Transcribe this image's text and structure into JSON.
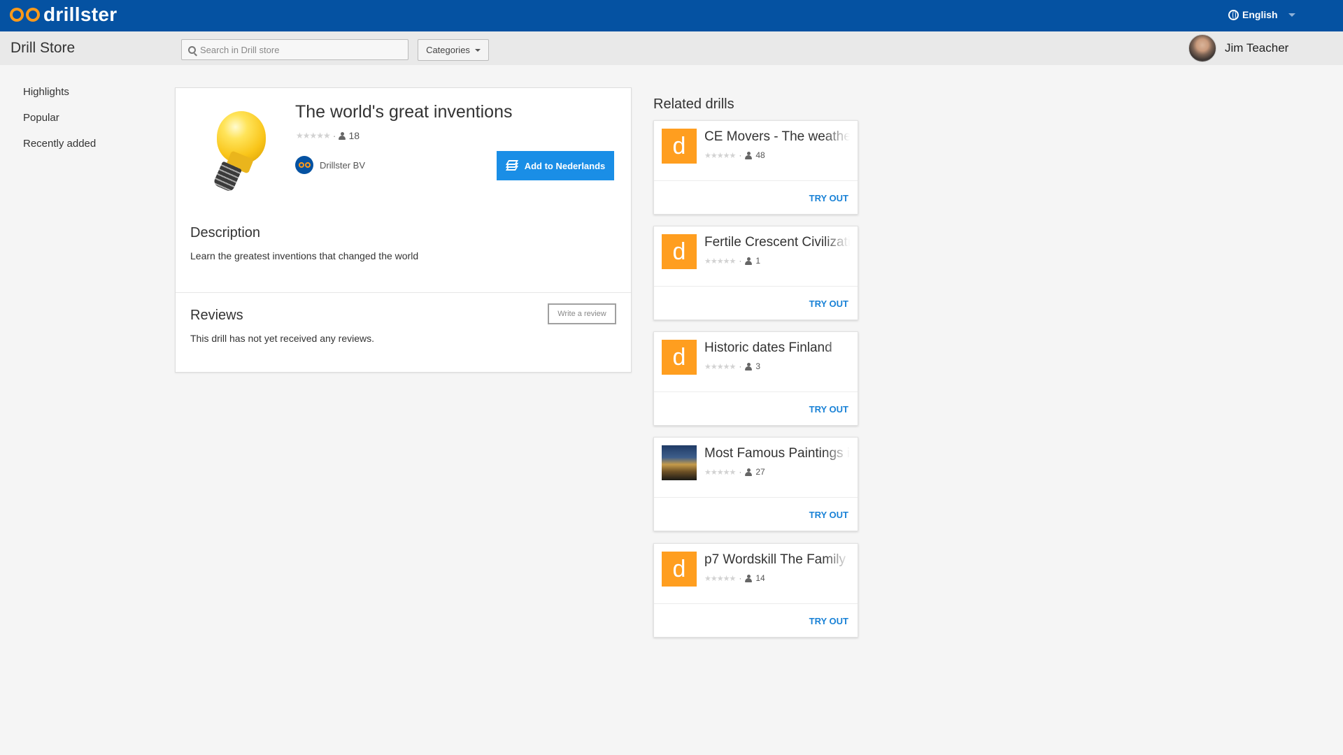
{
  "topbar": {
    "brand": "drillster",
    "language": "English"
  },
  "subbar": {
    "store_title": "Drill Store",
    "search_placeholder": "Search in Drill store",
    "categories_label": "Categories",
    "user_name": "Jim Teacher"
  },
  "nav": {
    "items": [
      "Highlights",
      "Popular",
      "Recently added"
    ]
  },
  "drill": {
    "title": "The world's great inventions",
    "rating_stars": "★★★★★",
    "rating_value": 0,
    "users_count": "18",
    "owner": "Drillster BV",
    "add_button_label": "Add to Nederlands",
    "description_heading": "Description",
    "description_text": "Learn the greatest inventions that changed the world",
    "reviews_heading": "Reviews",
    "reviews_text": "This drill has not yet received any reviews.",
    "write_review_label": "Write a review"
  },
  "related": {
    "heading": "Related drills",
    "try_out_label": "TRY OUT",
    "stars": "★★★★★",
    "items": [
      {
        "title": "CE Movers - The weathe",
        "thumb_letter": "d",
        "users": "48"
      },
      {
        "title": "Fertile Crescent Civilizati",
        "thumb_letter": "d",
        "users": "1"
      },
      {
        "title": "Historic dates Finland",
        "thumb_letter": "d",
        "users": "3"
      },
      {
        "title": "Most Famous Paintings i",
        "thumb_letter": "",
        "users": "27"
      },
      {
        "title": "p7 Wordskill The Family",
        "thumb_letter": "d",
        "users": "14"
      }
    ]
  },
  "colors": {
    "topbar": "#0552a2",
    "accent_orange": "#ff9e1f",
    "primary_button": "#1a8ee6",
    "link_blue": "#1a82d6"
  },
  "icons": {
    "logo": "drillster-eyes-icon",
    "language": "globe-icon",
    "search": "search-icon",
    "user_count": "person-icon",
    "add": "layers-icon"
  }
}
